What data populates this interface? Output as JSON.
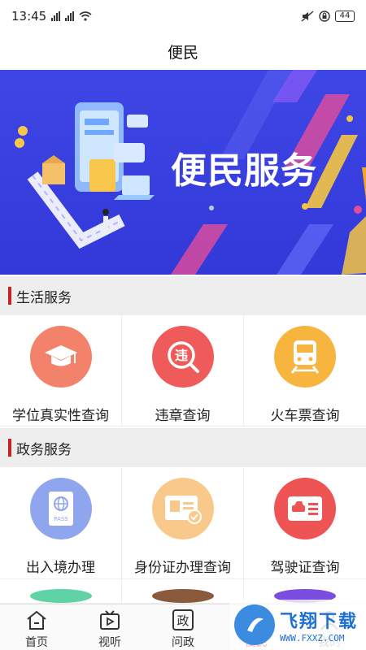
{
  "status_bar": {
    "time": "13:45",
    "battery": "44"
  },
  "header": {
    "title": "便民"
  },
  "banner": {
    "title": "便民服务"
  },
  "sections": [
    {
      "title": "生活服务",
      "items": [
        {
          "label": "学位真实性查询",
          "icon": "graduation-cap-icon",
          "color": "#f2826a"
        },
        {
          "label": "违章查询",
          "icon": "violation-search-icon",
          "color": "#ef5a5a"
        },
        {
          "label": "火车票查询",
          "icon": "train-icon",
          "color": "#f7b540"
        }
      ]
    },
    {
      "title": "政务服务",
      "items": [
        {
          "label": "出入境办理",
          "icon": "passport-icon",
          "color": "#8fa6ef"
        },
        {
          "label": "身份证办理查询",
          "icon": "id-card-icon",
          "color": "#f8c98a"
        },
        {
          "label": "驾驶证查询",
          "icon": "driver-license-icon",
          "color": "#ee5454"
        }
      ]
    }
  ],
  "tabbar": {
    "items": [
      {
        "label": "首页",
        "icon": "home-icon"
      },
      {
        "label": "视听",
        "icon": "tv-icon"
      },
      {
        "label": "问政",
        "icon": "zheng-icon",
        "glyph": "政"
      },
      {
        "label": "便民",
        "icon": "service-icon",
        "active": true
      },
      {
        "label": "我的",
        "icon": "user-icon"
      }
    ]
  },
  "watermark": {
    "main": "飞翔下载",
    "sub": "WWW.FXXZ.COM"
  }
}
